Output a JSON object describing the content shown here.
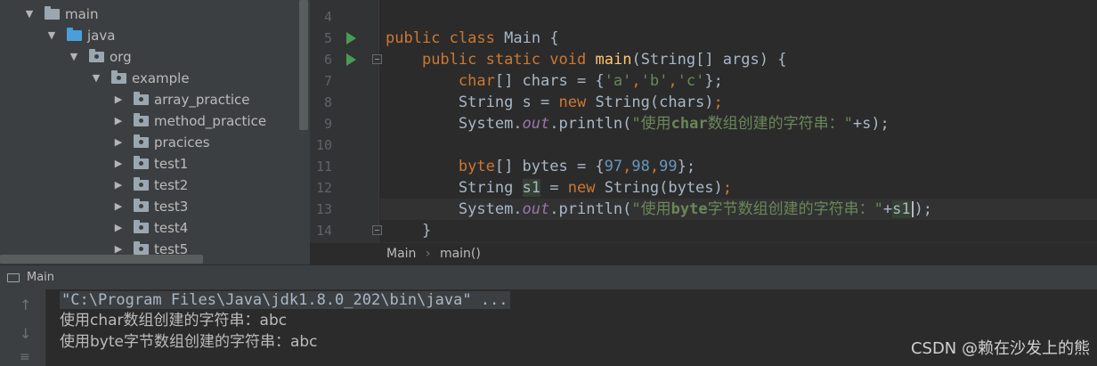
{
  "project_tree": {
    "items": [
      {
        "label": "main",
        "expanded": true,
        "icon": "folder-icon"
      },
      {
        "label": "java",
        "expanded": true,
        "icon": "source-folder-icon"
      },
      {
        "label": "org",
        "expanded": true,
        "icon": "package-icon"
      },
      {
        "label": "example",
        "expanded": true,
        "icon": "package-icon"
      },
      {
        "label": "array_practice",
        "expanded": false,
        "icon": "package-icon"
      },
      {
        "label": "method_practice",
        "expanded": false,
        "icon": "package-icon"
      },
      {
        "label": "pracices",
        "expanded": false,
        "icon": "package-icon"
      },
      {
        "label": "test1",
        "expanded": false,
        "icon": "package-icon"
      },
      {
        "label": "test2",
        "expanded": false,
        "icon": "package-icon"
      },
      {
        "label": "test3",
        "expanded": false,
        "icon": "package-icon"
      },
      {
        "label": "test4",
        "expanded": false,
        "icon": "package-icon"
      },
      {
        "label": "test5",
        "expanded": false,
        "icon": "package-icon"
      }
    ]
  },
  "editor": {
    "line_numbers": [
      "4",
      "5",
      "6",
      "7",
      "8",
      "9",
      "10",
      "11",
      "12",
      "13",
      "14"
    ],
    "code": {
      "l5_public": "public",
      "l5_class": "class",
      "l5_name": "Main",
      "l5_brace": "{",
      "l6_public": "public",
      "l6_static": "static",
      "l6_void": "void",
      "l6_main": "main",
      "l6_sig": "(String[] args) {",
      "l7_char": "char",
      "l7_decl": "[] chars = {",
      "l7_a": "'a'",
      "l7_b": "'b'",
      "l7_c": "'c'",
      "l7_end": "};",
      "l8_decl": "String s = ",
      "l8_new": "new",
      "l8_rest": " String(chars)",
      "l8_semi": ";",
      "l9_sys": "System.",
      "l9_out": "out",
      "l9_println": ".println(",
      "l9_str1": "\"使用",
      "l9_bold": "char",
      "l9_str2": "数组创建的字符串：\"",
      "l9_end": "+s);",
      "l11_byte": "byte",
      "l11_decl": "[] bytes = {",
      "l11_n1": "97",
      "l11_n2": "98",
      "l11_n3": "99",
      "l11_end": "};",
      "l12_decl": "String ",
      "l12_var": "s1",
      "l12_eq": " = ",
      "l12_new": "new",
      "l12_rest": " String(bytes)",
      "l12_semi": ";",
      "l13_sys": "System.",
      "l13_out": "out",
      "l13_println": ".println(",
      "l13_str1": "\"使用",
      "l13_bold": "byte",
      "l13_str2": "字节数组创建的字符串：\"",
      "l13_plus": "+",
      "l13_var": "s1",
      "l13_end": ");",
      "l14_brace": "}"
    },
    "breadcrumb": [
      "Main",
      "main()"
    ],
    "breadcrumb_sep": "›"
  },
  "run_panel": {
    "title": "Main",
    "lines": [
      "\"C:\\Program Files\\Java\\jdk1.8.0_202\\bin\\java\" ...",
      "使用char数组创建的字符串：abc",
      "使用byte字节数组创建的字符串：abc"
    ]
  },
  "watermark": "CSDN @赖在沙发上的熊",
  "colors": {
    "keyword": "#cc7832",
    "number": "#6897bb",
    "string": "#6a8759",
    "method": "#ffc66d",
    "field": "#9876aa",
    "run_green": "#499c54"
  }
}
